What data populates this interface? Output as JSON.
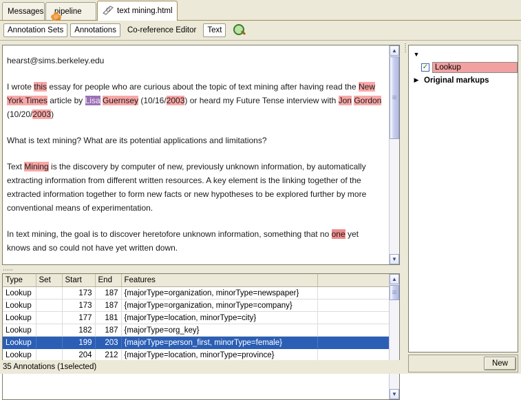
{
  "tabs": [
    {
      "label": "Messages",
      "icon": "none",
      "active": false
    },
    {
      "label": "pipeline",
      "icon": "flower-icon",
      "active": false
    },
    {
      "label": "text mining.html",
      "icon": "document-icon",
      "active": true
    }
  ],
  "toolbar": {
    "annotation_sets": "Annotation Sets",
    "annotations": "Annotations",
    "coreference_editor": "Co-reference Editor",
    "text": "Text",
    "search_icon": "magnifier-icon"
  },
  "document": {
    "email": "hearst@sims.berkeley.edu",
    "paragraphs": [
      {
        "runs": [
          {
            "t": "I wrote ",
            "h": "none"
          },
          {
            "t": "this",
            "h": "pink"
          },
          {
            "t": " essay for people who are curious about the topic of text mining after having read the ",
            "h": "none"
          },
          {
            "t": "New York Times",
            "h": "pink"
          },
          {
            "t": " article by ",
            "h": "none"
          },
          {
            "t": "Lisa",
            "h": "purple"
          },
          {
            "t": " ",
            "h": "none"
          },
          {
            "t": "Guernsey",
            "h": "pink"
          },
          {
            "t": " (10/16/",
            "h": "none"
          },
          {
            "t": "2003",
            "h": "pink"
          },
          {
            "t": ") or heard my Future Tense interview with ",
            "h": "none"
          },
          {
            "t": "Jon",
            "h": "pink"
          },
          {
            "t": " ",
            "h": "none"
          },
          {
            "t": "Gordon",
            "h": "pink"
          },
          {
            "t": " (10/20/",
            "h": "none"
          },
          {
            "t": "2003",
            "h": "pink"
          },
          {
            "t": ")",
            "h": "none"
          }
        ]
      },
      {
        "runs": [
          {
            "t": "What is text mining? What are its potential applications and limitations?",
            "h": "none"
          }
        ]
      },
      {
        "runs": [
          {
            "t": "Text ",
            "h": "none"
          },
          {
            "t": "Mining",
            "h": "pink"
          },
          {
            "t": " is the discovery by computer of new, previously unknown information, by automatically extracting information from different written resources. A key element is the linking together of the extracted information together to form new facts or new hypotheses to be explored further by more conventional means of experimentation.",
            "h": "none"
          }
        ]
      },
      {
        "runs": [
          {
            "t": "In text mining, the goal is to discover heretofore unknown information, something that no ",
            "h": "none"
          },
          {
            "t": "one",
            "h": "pink-dark"
          },
          {
            "t": " yet knows and so could not have yet written down.",
            "h": "none"
          }
        ]
      }
    ]
  },
  "annotations_table": {
    "columns": [
      "Type",
      "Set",
      "Start",
      "End",
      "Features"
    ],
    "rows": [
      {
        "type": "Lookup",
        "set": "",
        "start": "173",
        "end": "187",
        "features": "{majorType=organization, minorType=newspaper}",
        "selected": false
      },
      {
        "type": "Lookup",
        "set": "",
        "start": "173",
        "end": "187",
        "features": "{majorType=organization, minorType=company}",
        "selected": false
      },
      {
        "type": "Lookup",
        "set": "",
        "start": "177",
        "end": "181",
        "features": "{majorType=location, minorType=city}",
        "selected": false
      },
      {
        "type": "Lookup",
        "set": "",
        "start": "182",
        "end": "187",
        "features": "{majorType=org_key}",
        "selected": false
      },
      {
        "type": "Lookup",
        "set": "",
        "start": "199",
        "end": "203",
        "features": "{majorType=person_first, minorType=female}",
        "selected": true
      },
      {
        "type": "Lookup",
        "set": "",
        "start": "204",
        "end": "212",
        "features": "{majorType=location, minorType=province}",
        "selected": false
      }
    ]
  },
  "status": {
    "text": "35 Annotations (1selected)"
  },
  "annotation_sets_tree": {
    "root_toggle": "expanded",
    "items": [
      {
        "label": "Lookup",
        "checked": true,
        "highlight_color": "#f2a1a1",
        "bold": false
      },
      {
        "label": "Original markups",
        "checked": false,
        "expander": "collapsed",
        "bold": true
      }
    ],
    "new_button": "New"
  },
  "colors": {
    "window_bg": "#ece9d8",
    "pane_bg": "#ffffff",
    "selection_blue": "#2b5fb5",
    "highlight_pink": "#f9a7a7",
    "highlight_purple": "#9b71b5",
    "scrollbar_thumb": "#b3bce6"
  }
}
